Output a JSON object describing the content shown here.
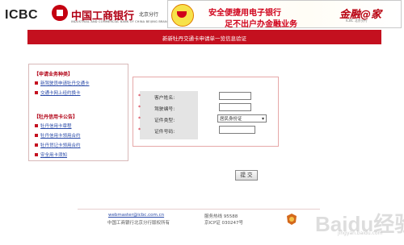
{
  "header": {
    "logo_text": "ICBC",
    "bank_name": "中国工商银行",
    "branch": "北京分行",
    "bank_en": "INDUSTRIAL AND COMMERCIAL BANK OF CHINA    BEIJING BRANCH",
    "banner": {
      "line1": "安全便捷用电子银行",
      "line2": "足不出户办金融业务",
      "brand": "金融@家",
      "brand_sub": "ICBC 北京分行"
    }
  },
  "title_bar": "新新牡丹交通卡申请单一览信息验证",
  "left_panel": {
    "section1_title": "【申请业务种类】",
    "section1_items": [
      "新驾驶员申请牡丹交通卡",
      "交通卡网上经约换卡"
    ],
    "section2_title": "【牡丹信用卡公告】",
    "section2_items": [
      "牡丹信用卡章程",
      "牡丹信用卡领用合约",
      "牡丹贷记卡领用合约",
      "安全用卡须知"
    ]
  },
  "form": {
    "fields": [
      {
        "label": "客户姓名:",
        "value": ""
      },
      {
        "label": "驾驶编号:",
        "value": ""
      },
      {
        "label": "证件类型:",
        "value": "居民身份证"
      },
      {
        "label": "证件号码:",
        "value": ""
      }
    ],
    "required_mark": "*",
    "submit_label": "提 交"
  },
  "footer": {
    "email": "webmaster@icbc.com.cn",
    "copyright": "中国工商银行北京分行版权所有",
    "hotline": "服务热线 95588",
    "icp": "京ICP证 030247号"
  },
  "watermark": {
    "text": "Baidu经验",
    "sub": "jingyan.baidu.com"
  },
  "colors": {
    "brand_red": "#c4101f",
    "link_blue": "#2a4aa8"
  }
}
